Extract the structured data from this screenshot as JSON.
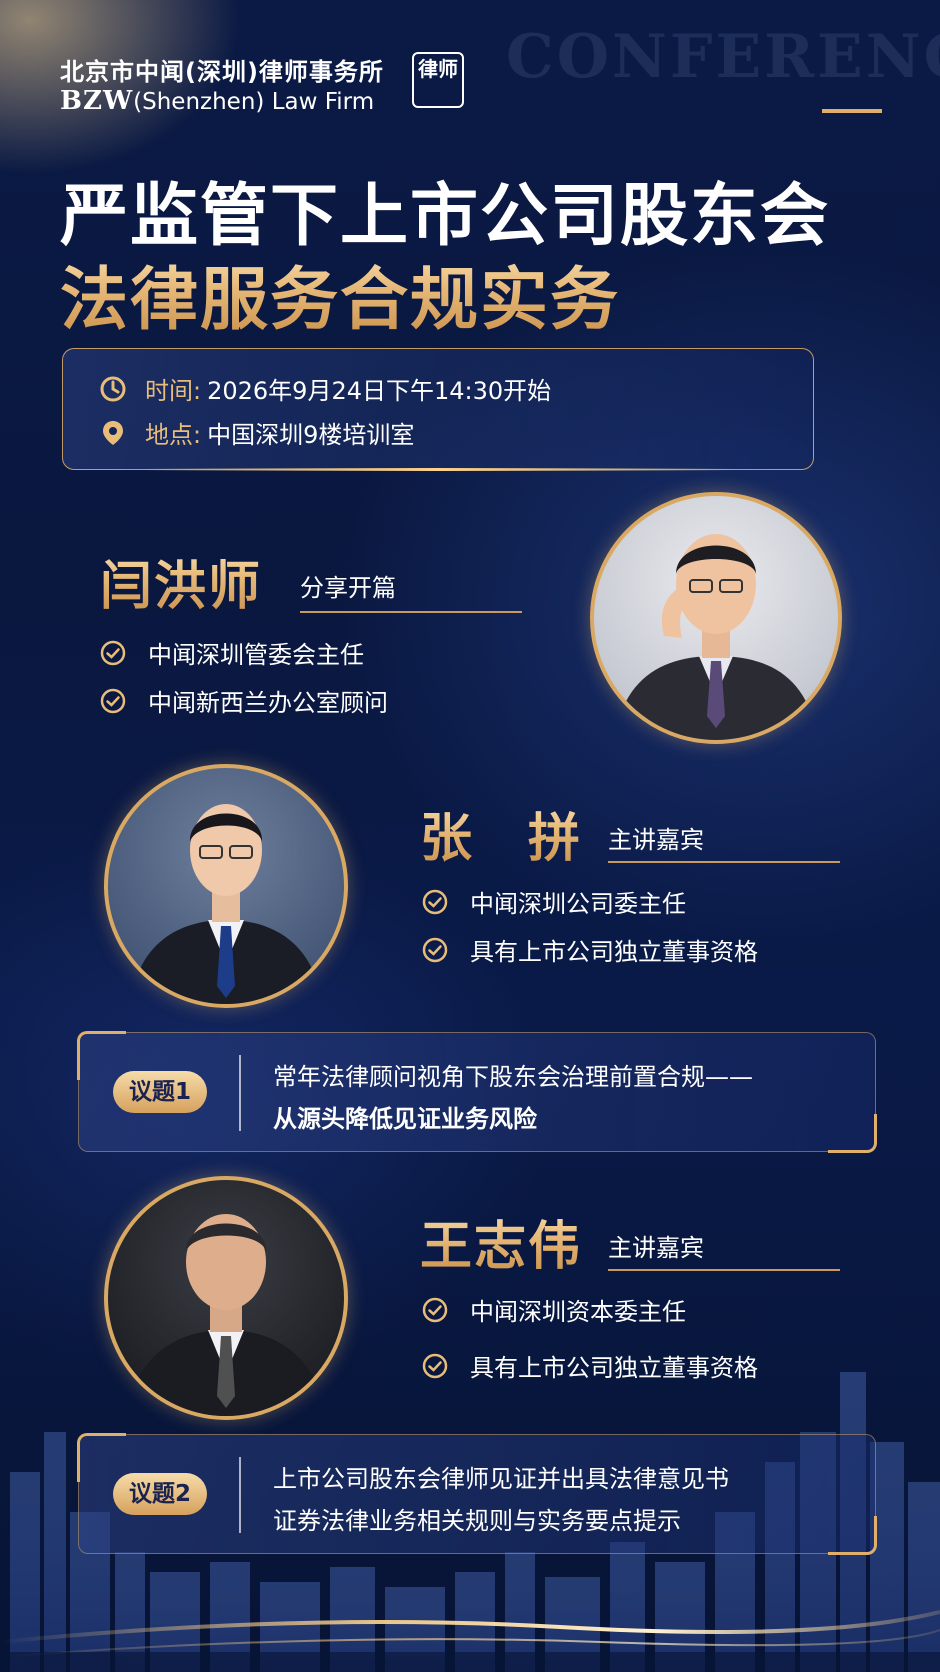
{
  "firm": {
    "name_cn": "北京市中闻(深圳)律师事务所",
    "name_en_mark": "BZW",
    "name_en_rest": "(Shenzhen) Law Firm",
    "seal_text": "律师"
  },
  "watermark": "CONFERENCE",
  "title": {
    "line1": "严监管下上市公司股东会",
    "line2": "法律服务合规实务"
  },
  "event": {
    "time_label": "时间:",
    "time_value": "2026年9月24日下午14:30开始",
    "place_label": "地点:",
    "place_value": "中国深圳9楼培训室"
  },
  "speakers": [
    {
      "name": "闫洪师",
      "role": "分享开篇",
      "bullets": [
        "中闻深圳管委会主任",
        "中闻新西兰办公室顾问"
      ]
    },
    {
      "name": "张　拼",
      "role": "主讲嘉宾",
      "bullets": [
        "中闻深圳公司委主任",
        "具有上市公司独立董事资格"
      ]
    },
    {
      "name": "王志伟",
      "role": "主讲嘉宾",
      "bullets": [
        "中闻深圳资本委主任",
        "具有上市公司独立董事资格"
      ]
    }
  ],
  "topics": [
    {
      "tag": "议题1",
      "lines": [
        "常年法律顾问视角下股东会治理前置合规——",
        "从源头降低见证业务风险"
      ]
    },
    {
      "tag": "议题2",
      "lines": [
        "上市公司股东会律师见证并出具法律意见书",
        "证券法律业务相关规则与实务要点提示"
      ]
    }
  ],
  "colors": {
    "background": "#0a1840",
    "gold": "#e8bd7a",
    "gold_dark": "#c98f4a",
    "text": "#ffffff"
  },
  "icons": {
    "time": "clock-icon",
    "place": "map-pin-icon",
    "bullet": "check-circle-icon"
  }
}
